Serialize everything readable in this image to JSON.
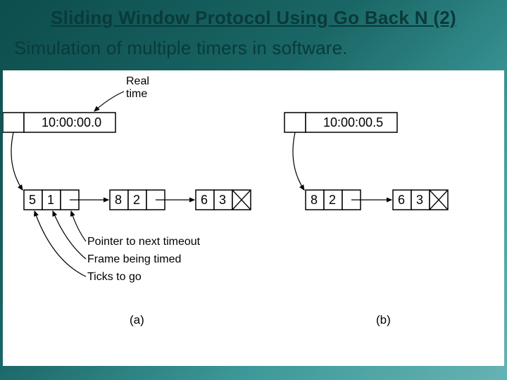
{
  "title": "Sliding Window Protocol Using Go Back N (2)",
  "subtitle": "Simulation of multiple timers in software.",
  "labels": {
    "real_time": "Real\ntime",
    "pointer": "Pointer to next timeout",
    "frame": "Frame being timed",
    "ticks": "Ticks to go",
    "a": "(a)",
    "b": "(b)"
  },
  "clock_a": "10:00:00.0",
  "clock_b": "10:00:00.5",
  "list_a": [
    {
      "ticks": "5",
      "frame": "1"
    },
    {
      "ticks": "8",
      "frame": "2"
    },
    {
      "ticks": "6",
      "frame": "3"
    }
  ],
  "list_b": [
    {
      "ticks": "8",
      "frame": "2"
    },
    {
      "ticks": "6",
      "frame": "3"
    }
  ],
  "chart_data": {
    "type": "table",
    "title": "Timer linked-list snapshots in Go-Back-N simulation",
    "series": [
      {
        "name": "(a) at 10:00:00.0",
        "values": [
          {
            "frame": 1,
            "ticks_to_go": 5
          },
          {
            "frame": 2,
            "ticks_to_go": 8
          },
          {
            "frame": 3,
            "ticks_to_go": 6
          }
        ]
      },
      {
        "name": "(b) at 10:00:00.5",
        "values": [
          {
            "frame": 2,
            "ticks_to_go": 8
          },
          {
            "frame": 3,
            "ticks_to_go": 6
          }
        ]
      }
    ],
    "annotations": [
      "Pointer to next timeout",
      "Frame being timed",
      "Ticks to go",
      "Real time"
    ]
  }
}
